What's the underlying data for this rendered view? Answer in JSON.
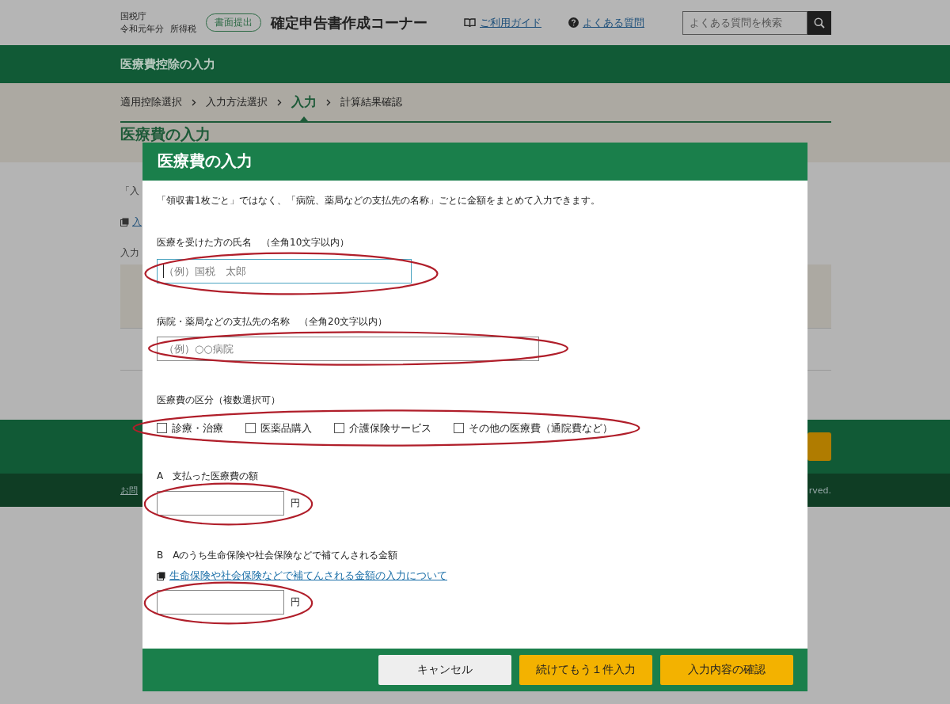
{
  "header": {
    "agency": "国税庁",
    "year": "令和元年分",
    "tax": "所得税",
    "badge": "書面提出",
    "title": "確定申告書作成コーナー",
    "links": [
      {
        "kind": "guide",
        "label": "ご利用ガイド"
      },
      {
        "kind": "faq",
        "label": "よくある質問"
      }
    ],
    "search": {
      "placeholder": "よくある質問を検索"
    }
  },
  "section_bar": {
    "title": "医療費控除の入力"
  },
  "breadcrumb": [
    {
      "label": "適用控除選択",
      "selected": false
    },
    {
      "label": "入力方法選択",
      "selected": false
    },
    {
      "label": "入力",
      "selected": true
    },
    {
      "label": "計算結果確認",
      "selected": false
    }
  ],
  "page_heading": "医療費の入力",
  "background": {
    "intro_fragment": "「入",
    "link_fragment": "入",
    "label_fragment": "入力",
    "contact_fragment": "お問",
    "copyright_fragment": "rved."
  },
  "modal": {
    "title": "医療費の入力",
    "description": "「領収書1枚ごと」ではなく、「病院、薬局などの支払先の名称」ごとに金額をまとめて入力できます。",
    "fields": [
      {
        "kind": "text",
        "label": "医療を受けた方の氏名　（全角10文字以内）",
        "placeholder": "（例）国税　太郎",
        "focused": true
      },
      {
        "kind": "text",
        "label": "病院・薬局などの支払先の名称　（全角20文字以内）",
        "placeholder": "（例）○○病院",
        "focused": false
      },
      {
        "kind": "checkboxes",
        "label": "医療費の区分（複数選択可）",
        "options": [
          {
            "label": "診療・治療",
            "checked": false
          },
          {
            "label": "医薬品購入",
            "checked": false
          },
          {
            "label": "介護保険サービス",
            "checked": false
          },
          {
            "label": "その他の医療費（通院費など）",
            "checked": false
          }
        ]
      },
      {
        "kind": "amount",
        "label": "A　支払った医療費の額",
        "unit": "円"
      },
      {
        "kind": "amount",
        "label": "B　Aのうち生命保険や社会保険などで補てんされる金額",
        "link": "生命保険や社会保険などで補てんされる金額の入力について",
        "unit": "円"
      }
    ],
    "buttons": [
      {
        "kind": "secondary",
        "label": "キャンセル"
      },
      {
        "kind": "primary",
        "label": "続けてもう１件入力"
      },
      {
        "kind": "primary",
        "label": "入力内容の確認"
      }
    ]
  }
}
